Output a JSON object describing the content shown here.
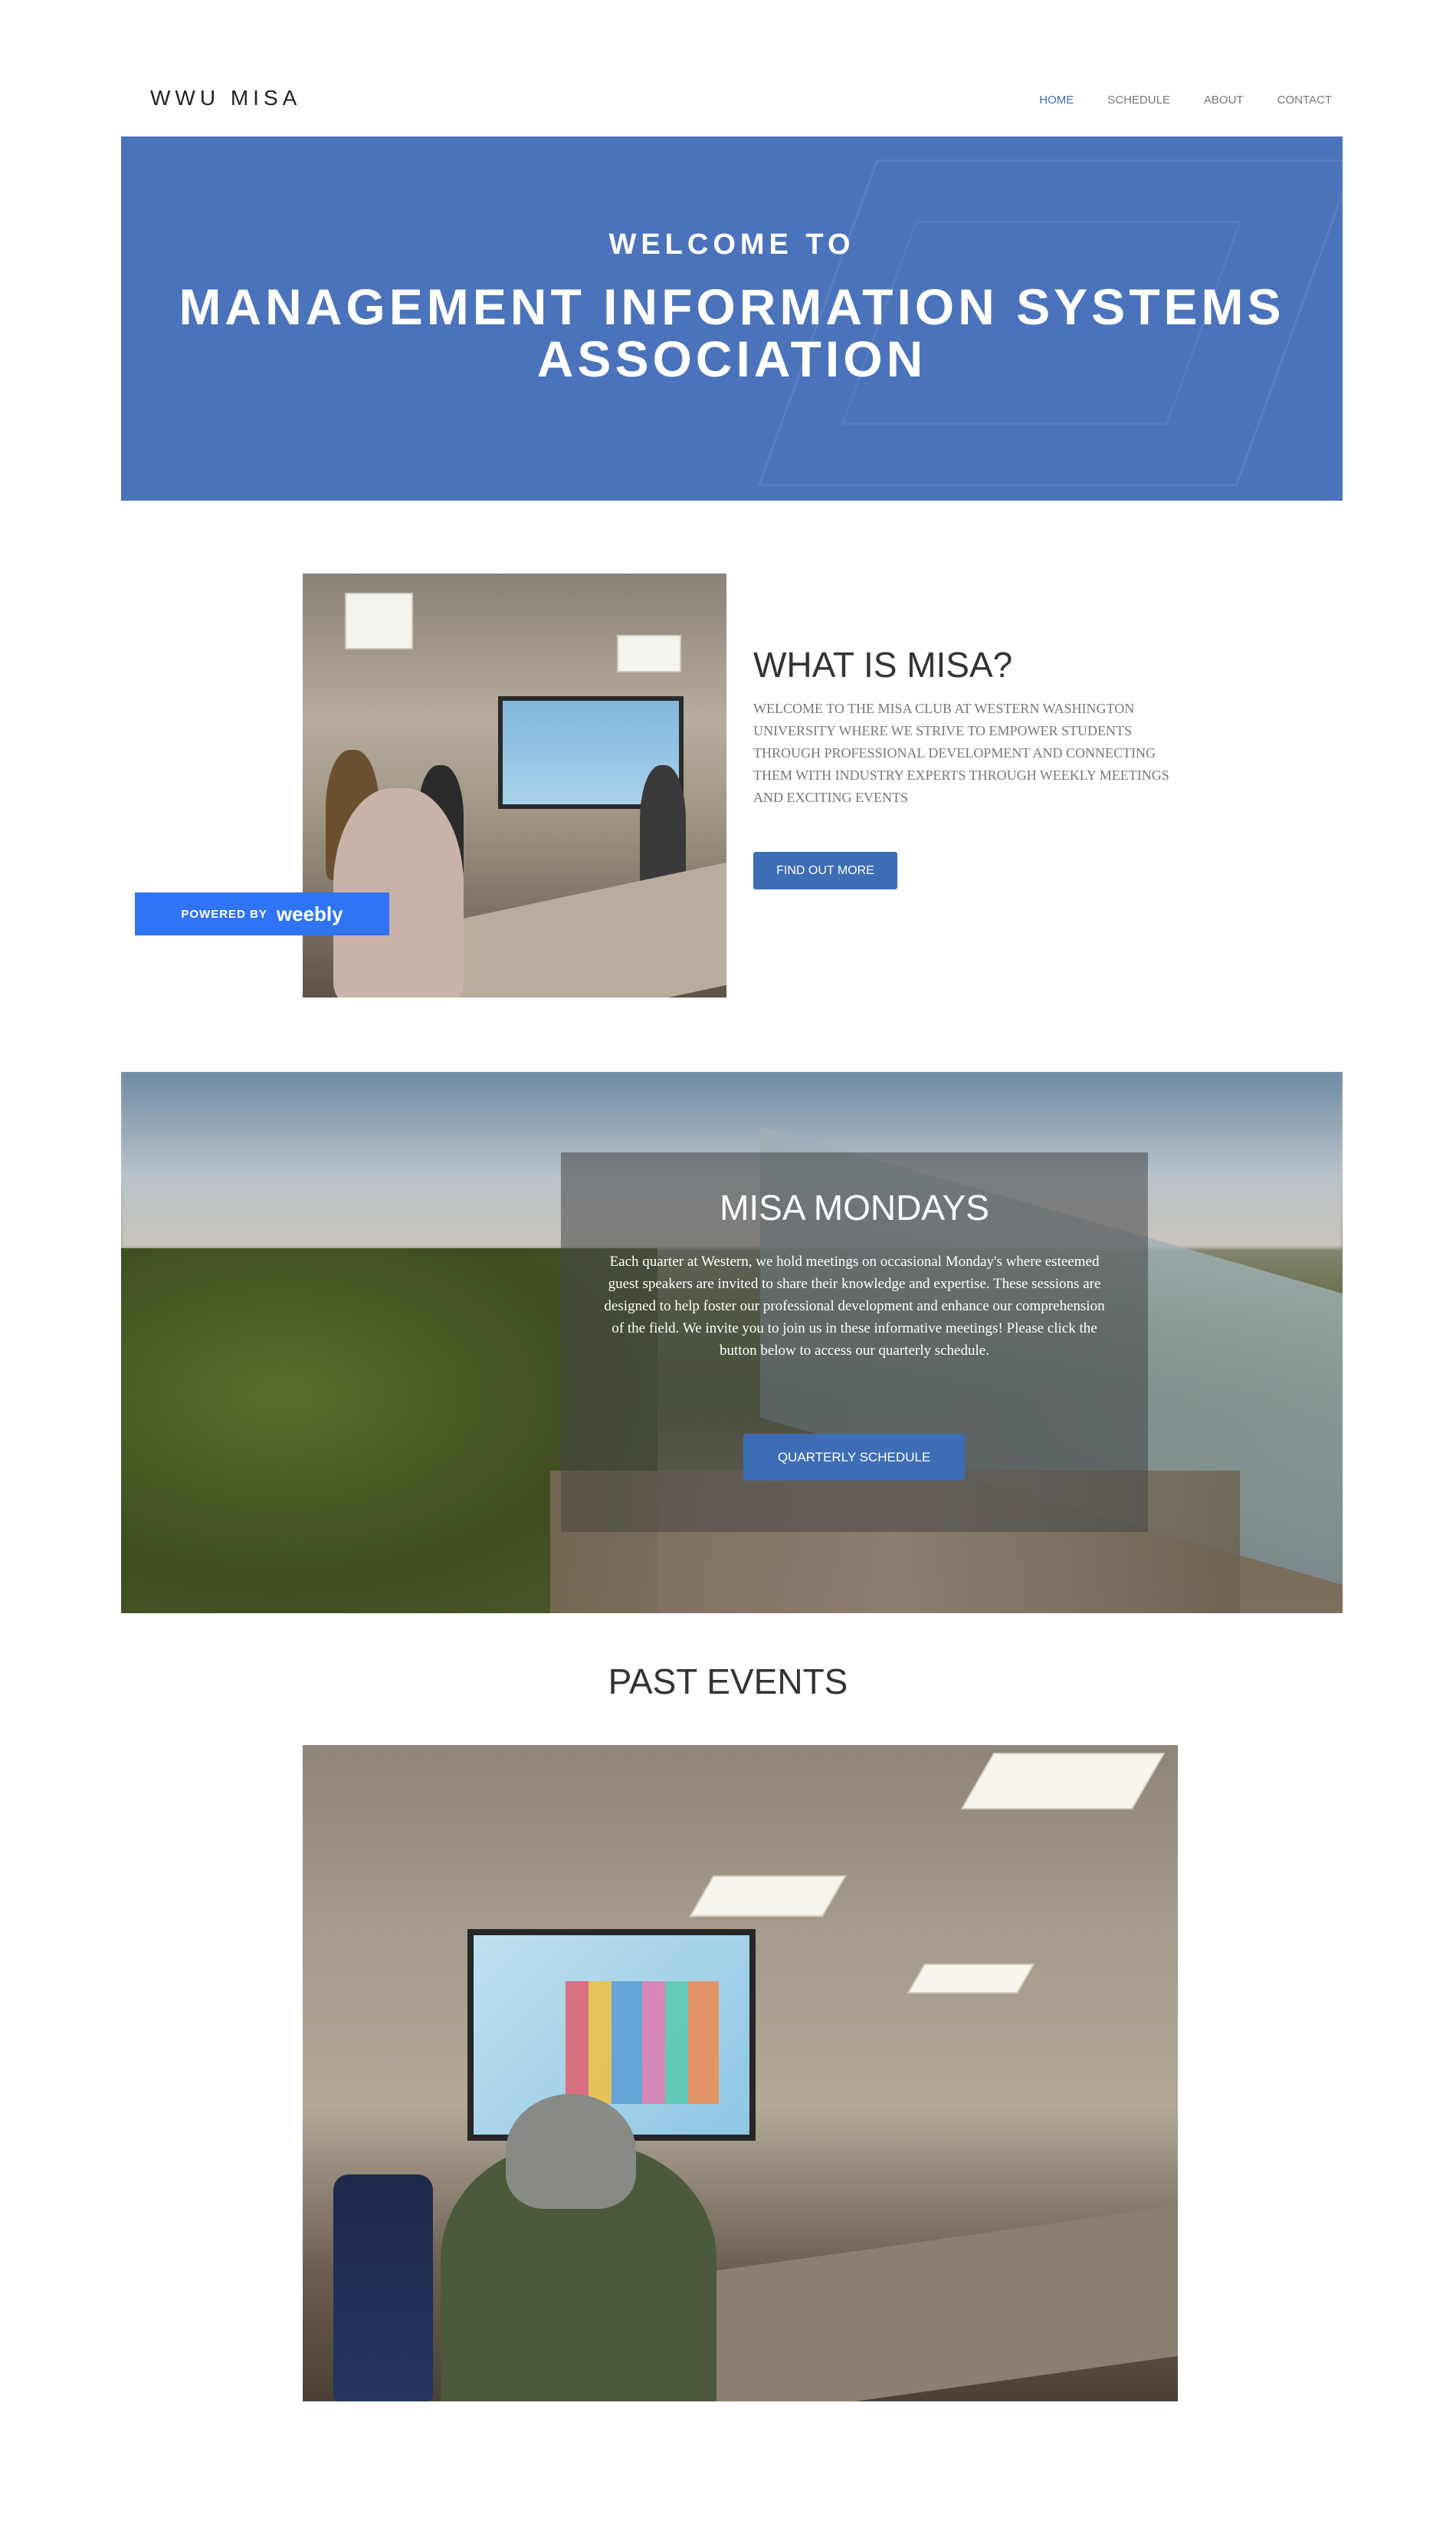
{
  "header": {
    "brand": "WWU MISA",
    "nav": [
      {
        "label": "HOME"
      },
      {
        "label": "SCHEDULE"
      },
      {
        "label": "ABOUT"
      },
      {
        "label": "CONTACT"
      }
    ]
  },
  "hero": {
    "kicker": "WELCOME TO",
    "title": "MANAGEMENT INFORMATION SYSTEMS ASSOCIATION",
    "bg_color": "#4b73bb"
  },
  "about": {
    "title": "WHAT IS MISA?",
    "text": "WELCOME TO THE MISA CLUB AT WESTERN WASHINGTON UNIVERSITY WHERE WE STRIVE TO EMPOWER STUDENTS THROUGH PROFESSIONAL DEVELOPMENT AND CONNECTING THEM WITH INDUSTRY EXPERTS THROUGH WEEKLY MEETINGS AND EXCITING EVENTS",
    "button": "FIND OUT MORE"
  },
  "badge": {
    "small": "POWERED BY",
    "big": "weebly",
    "color": "#2f74f5"
  },
  "mondays": {
    "title": "MISA MONDAYS",
    "text": "Each quarter at Western, we hold meetings on occasional Monday's where esteemed guest speakers are invited to share their knowledge and expertise. These sessions are designed to help foster our professional development and enhance our comprehension of the field. We invite you to join us in these informative meetings! Please click the button below to access our quarterly schedule.",
    "button": "QUARTERLY SCHEDULE"
  },
  "past": {
    "title": "PAST EVENTS"
  },
  "colors": {
    "accent": "#3d6db5",
    "nav_active": "#3b6fbf"
  }
}
